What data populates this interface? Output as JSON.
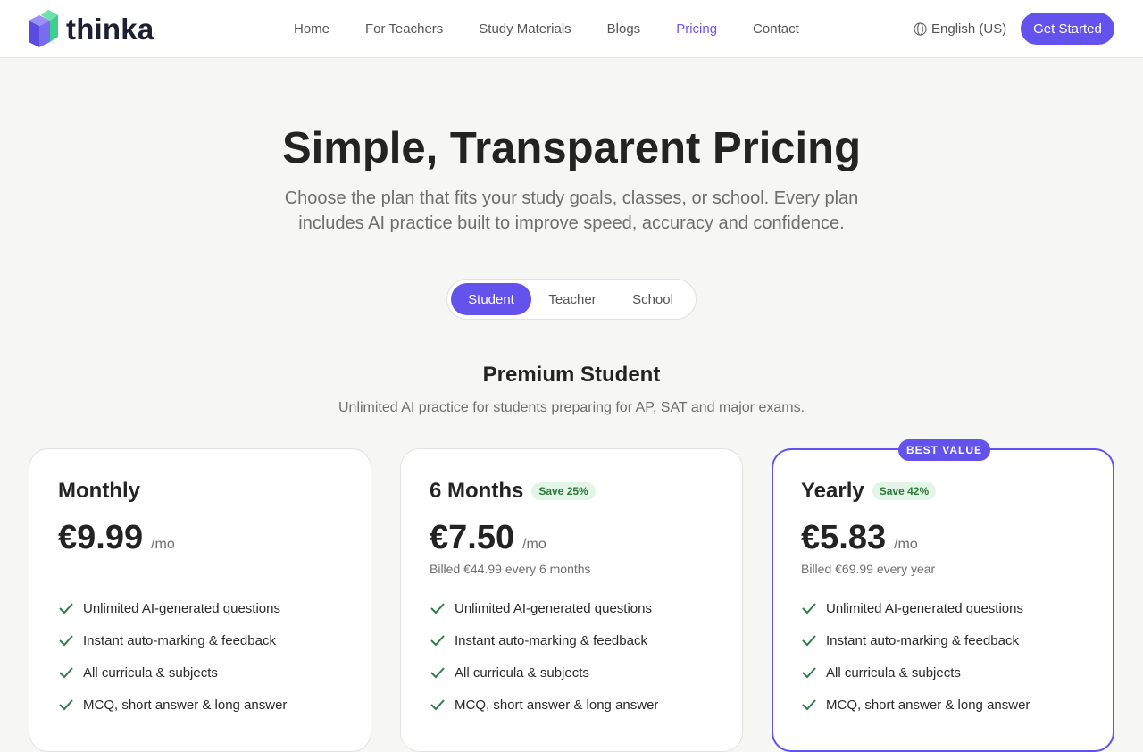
{
  "brand": {
    "name": "thinka",
    "accent": "#6352ec"
  },
  "nav": {
    "items": [
      {
        "label": "Home",
        "active": false
      },
      {
        "label": "For Teachers",
        "active": false
      },
      {
        "label": "Study Materials",
        "active": false
      },
      {
        "label": "Blogs",
        "active": false
      },
      {
        "label": "Pricing",
        "active": true
      },
      {
        "label": "Contact",
        "active": false
      }
    ],
    "language": "English (US)",
    "cta": "Get Started"
  },
  "hero": {
    "title": "Simple, Transparent Pricing",
    "subtitle": "Choose the plan that fits your study goals, classes, or school. Every plan includes AI practice built to improve speed, accuracy and confidence."
  },
  "toggle": {
    "options": [
      {
        "label": "Student",
        "active": true
      },
      {
        "label": "Teacher",
        "active": false
      },
      {
        "label": "School",
        "active": false
      }
    ]
  },
  "section": {
    "title": "Premium Student",
    "subtitle": "Unlimited AI practice for students preparing for AP, SAT and major exams."
  },
  "plans": [
    {
      "name": "Monthly",
      "save": "",
      "price": "€9.99",
      "period": "/mo",
      "billed": "",
      "best_value": "",
      "features": [
        "Unlimited AI-generated questions",
        "Instant auto-marking & feedback",
        "All curricula & subjects",
        "MCQ, short answer & long answer"
      ]
    },
    {
      "name": "6 Months",
      "save": "Save 25%",
      "price": "€7.50",
      "period": "/mo",
      "billed": "Billed €44.99 every 6 months",
      "best_value": "",
      "features": [
        "Unlimited AI-generated questions",
        "Instant auto-marking & feedback",
        "All curricula & subjects",
        "MCQ, short answer & long answer"
      ]
    },
    {
      "name": "Yearly",
      "save": "Save 42%",
      "price": "€5.83",
      "period": "/mo",
      "billed": "Billed €69.99 every year",
      "best_value": "BEST VALUE",
      "features": [
        "Unlimited AI-generated questions",
        "Instant auto-marking & feedback",
        "All curricula & subjects",
        "MCQ, short answer & long answer"
      ]
    }
  ]
}
